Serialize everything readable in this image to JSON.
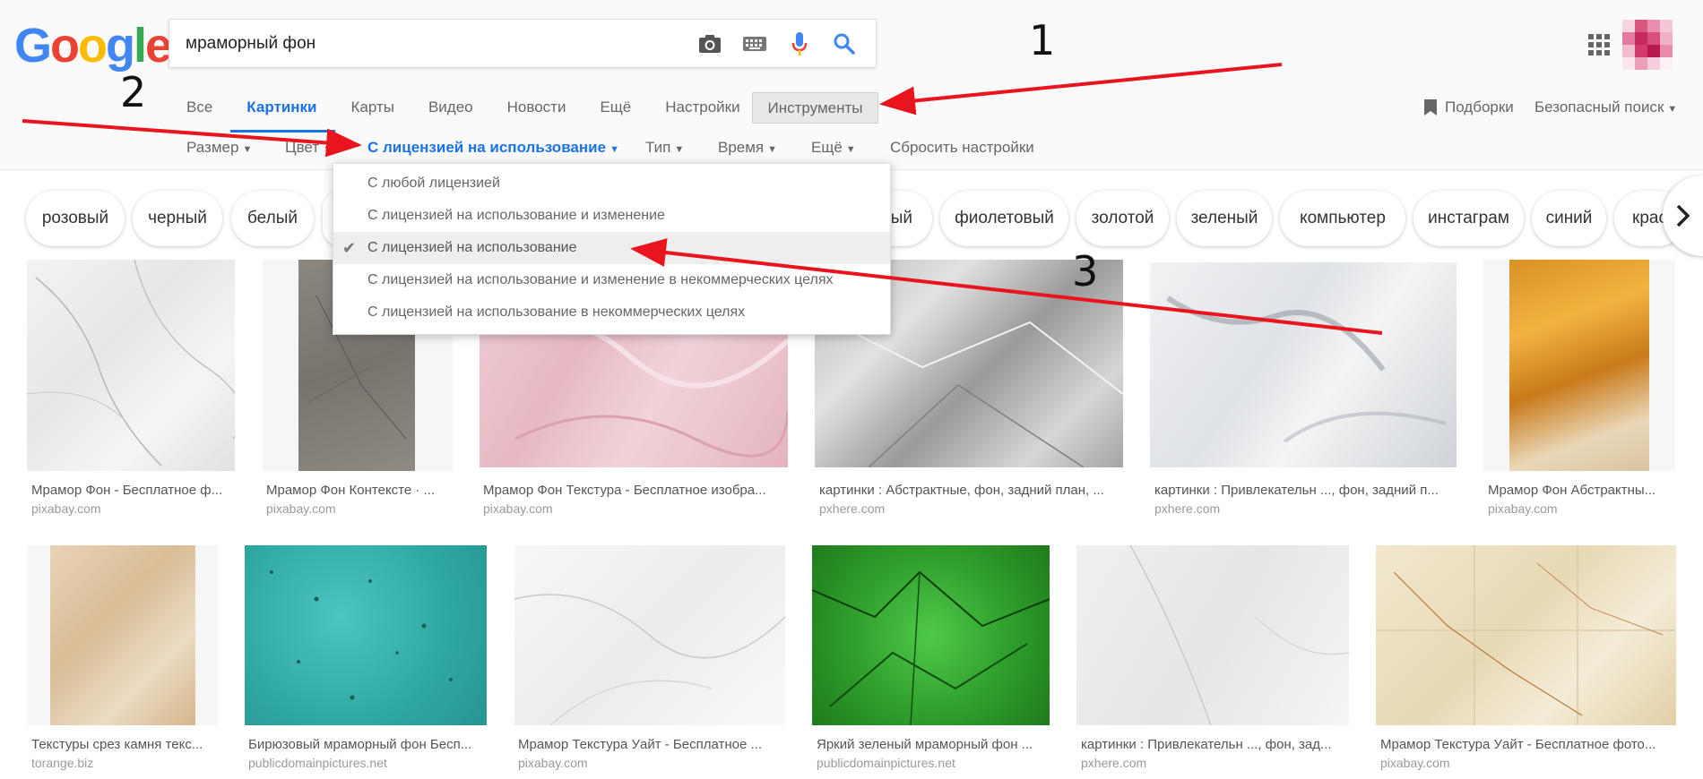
{
  "logo": {
    "letters": [
      "G",
      "o",
      "o",
      "g",
      "l",
      "e"
    ],
    "colors": [
      "#4285f4",
      "#ea4335",
      "#fbbc05",
      "#4285f4",
      "#34a853",
      "#ea4335"
    ]
  },
  "search": {
    "query": "мраморный фон",
    "icons": [
      "camera-icon",
      "keyboard-icon",
      "microphone-icon",
      "search-icon"
    ]
  },
  "tabs": [
    "Все",
    "Картинки",
    "Карты",
    "Видео",
    "Новости",
    "Ещё",
    "Настройки"
  ],
  "active_tab": "Картинки",
  "tools_label": "Инструменты",
  "collections_label": "Подборки",
  "safesearch_label": "Безопасный поиск",
  "filters": {
    "size": "Размер",
    "color": "Цвет",
    "license": "С лицензией на использование",
    "type": "Тип",
    "time": "Время",
    "more": "Ещё",
    "reset": "Сбросить настройки"
  },
  "license_menu": [
    "С любой лицензией",
    "С лицензией на использование и изменение",
    "С лицензией на использование",
    "С лицензией на использование и изменение в некоммерческих целях",
    "С лицензией на использование в некоммерческих целях"
  ],
  "license_selected_index": 2,
  "chips": [
    "розовый",
    "черный",
    "белый",
    "",
    "ый",
    "фиолетовый",
    "золотой",
    "зеленый",
    "компьютер",
    "инстаграм",
    "синий",
    "крас"
  ],
  "images_row1": [
    {
      "title": "Мрамор Фон - Бесплатное ф...",
      "source": "pixabay.com"
    },
    {
      "title": "Мрамор Фон Контексте · ...",
      "source": "pixabay.com"
    },
    {
      "title": "Мрамор Фон Текстура - Бесплатное изобра...",
      "source": "pixabay.com"
    },
    {
      "title": "картинки : Абстрактные, фон, задний план, ...",
      "source": "pxhere.com"
    },
    {
      "title": "картинки : Привлекательн ..., фон, задний п...",
      "source": "pxhere.com"
    },
    {
      "title": "Мрамор Фон Абстрактны...",
      "source": "pixabay.com"
    }
  ],
  "images_row2": [
    {
      "title": "Текстуры срез камня текс...",
      "source": "torange.biz"
    },
    {
      "title": "Бирюзовый мраморный фон Бесп...",
      "source": "publicdomainpictures.net"
    },
    {
      "title": "Мрамор Текстура Уайт - Бесплатное ...",
      "source": "pixabay.com"
    },
    {
      "title": "Яркий зеленый мраморный фон ...",
      "source": "publicdomainpictures.net"
    },
    {
      "title": "картинки : Привлекательн ..., фон, зад...",
      "source": "pxhere.com"
    },
    {
      "title": "Мрамор Текстура Уайт - Бесплатное фото...",
      "source": "pixabay.com"
    }
  ],
  "annotations": [
    "1",
    "2",
    "3"
  ],
  "colors": {
    "accent": "#1a73e8",
    "arrow": "#e8141e"
  }
}
